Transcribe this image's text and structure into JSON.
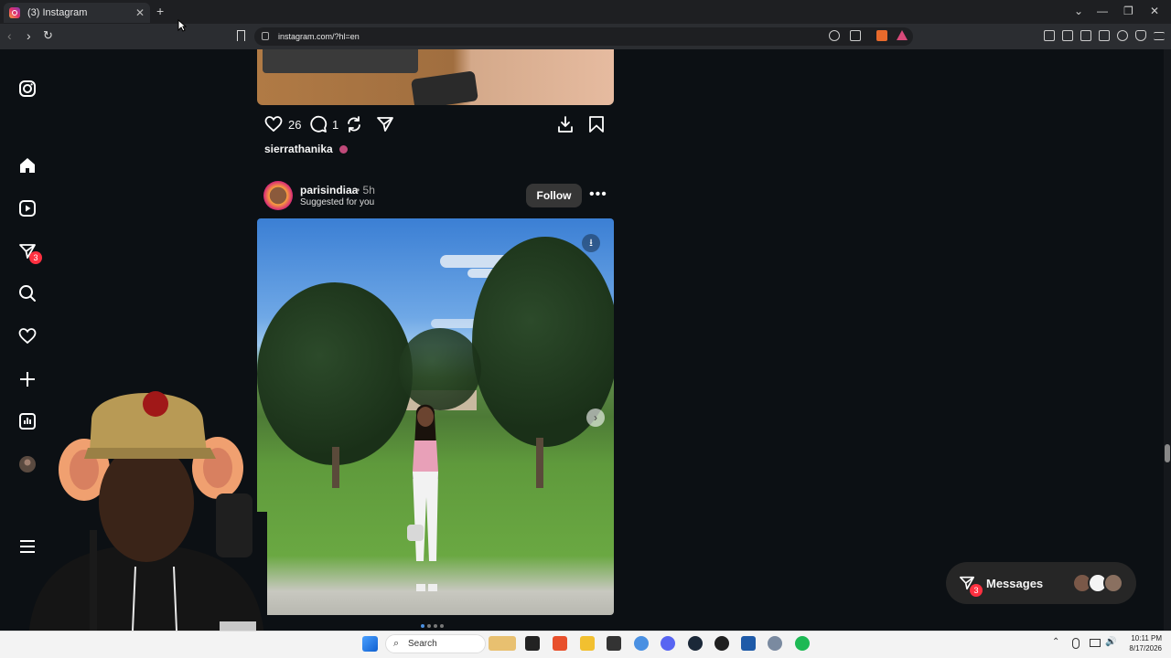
{
  "browser": {
    "tab_title": "(3) Instagram",
    "tab_close": "✕",
    "new_tab": "+",
    "url": "instagram.com/?hl=en",
    "window_controls": [
      "⌄",
      "—",
      "❐",
      "✕"
    ]
  },
  "sidebar": {
    "notification_badge": "3"
  },
  "previous_post": {
    "likes": "26",
    "comments": "1",
    "username": "sierrathanika"
  },
  "post": {
    "username": "parisindiaa",
    "time": "• 5h",
    "subtitle": "Suggested for you",
    "follow_label": "Follow",
    "more_label": "•••"
  },
  "messages": {
    "label": "Messages",
    "badge": "3"
  },
  "taskbar": {
    "search_placeholder": "Search",
    "time": "10:11 PM",
    "date": "8/17/2026"
  },
  "colors": {
    "background": "#0c1014",
    "badge": "#ff3040",
    "follow_button": "#363636"
  }
}
